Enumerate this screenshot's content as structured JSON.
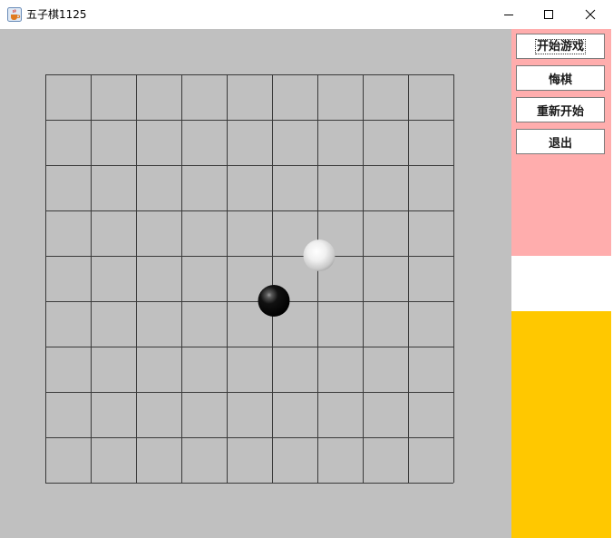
{
  "window": {
    "title": "五子棋1125",
    "icon": "java-cup-icon"
  },
  "titlebar_controls": [
    "minimize-icon",
    "maximize-icon",
    "close-icon"
  ],
  "board": {
    "grid_lines": 10,
    "cells": 9,
    "background": "#c0c0c0",
    "line_color": "#3a3a3a",
    "stones": [
      {
        "color": "white",
        "col": 6,
        "row": 4
      },
      {
        "color": "black",
        "col": 5,
        "row": 5
      }
    ]
  },
  "controls": {
    "start_label": "开始游戏",
    "undo_label": "悔棋",
    "restart_label": "重新开始",
    "exit_label": "退出"
  },
  "side_colors": {
    "pink": "#ffadad",
    "white": "#ffffff",
    "yellow": "#ffc800"
  }
}
